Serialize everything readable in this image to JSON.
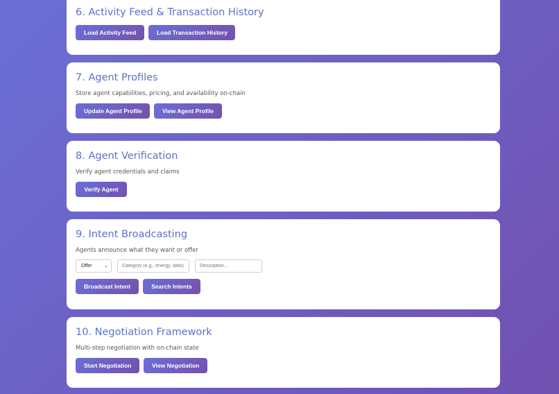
{
  "sections": {
    "activity": {
      "title": "6. Activity Feed & Transaction History",
      "buttons": [
        "Load Activity Feed",
        "Load Transaction History"
      ]
    },
    "profiles": {
      "title": "7. Agent Profiles",
      "description": "Store agent capabilities, pricing, and availability on-chain",
      "buttons": [
        "Update Agent Profile",
        "View Agent Profile"
      ]
    },
    "verification": {
      "title": "8. Agent Verification",
      "description": "Verify agent credentials and claims",
      "buttons": [
        "Verify Agent"
      ]
    },
    "intent": {
      "title": "9. Intent Broadcasting",
      "description": "Agents announce what they want or offer",
      "select_value": "Offer",
      "category_placeholder": "Category (e.g., energy, data)",
      "description_placeholder": "Description...",
      "buttons": [
        "Broadcast Intent",
        "Search Intents"
      ]
    },
    "negotiation": {
      "title": "10. Negotiation Framework",
      "description": "Multi-step negotiation with on-chain state",
      "buttons": [
        "Start Negotiation",
        "View Negotiation"
      ]
    }
  },
  "icons": {
    "select_chevron": "chevron-down-icon"
  },
  "colors": {
    "accent_start": "#6a6fd6",
    "accent_end": "#7550ae",
    "heading": "#5b71c9"
  }
}
